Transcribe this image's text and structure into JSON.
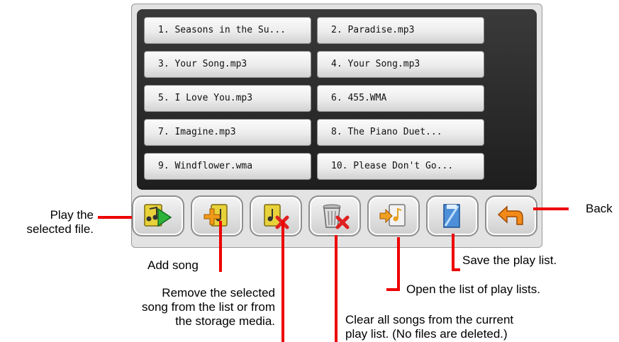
{
  "playlist": {
    "songs": [
      "1. Seasons in the Su...",
      "2. Paradise.mp3",
      "3. Your Song.mp3",
      "4. Your Song.mp3",
      "5. I Love You.mp3",
      "6. 455.WMA",
      "7. Imagine.mp3",
      "8. The Piano Duet...",
      "9. Windflower.wma",
      "10. Please Don't Go..."
    ]
  },
  "toolbar": {
    "buttons": [
      {
        "name": "play-button",
        "icon": "play-music-icon"
      },
      {
        "name": "add-song-button",
        "icon": "add-song-icon"
      },
      {
        "name": "remove-song-button",
        "icon": "remove-song-icon"
      },
      {
        "name": "clear-playlist-button",
        "icon": "clear-trash-icon"
      },
      {
        "name": "open-playlists-button",
        "icon": "open-list-icon"
      },
      {
        "name": "save-playlist-button",
        "icon": "save-list-icon"
      },
      {
        "name": "back-button",
        "icon": "back-arrow-icon"
      }
    ]
  },
  "annotations": {
    "play_l1": "Play the",
    "play_l2": "selected file.",
    "back": "Back",
    "add_song": "Add song",
    "remove_l1": "Remove the selected",
    "remove_l2": "song from the list or from",
    "remove_l3": "the storage media.",
    "clear_l1": "Clear all songs from the current",
    "clear_l2": "play list. (No files are deleted.)",
    "open": "Open the list of play lists.",
    "save": "Save the play list."
  },
  "colors": {
    "annotation_line": "#ee0000",
    "screen_bg": "#2a2a2a"
  }
}
